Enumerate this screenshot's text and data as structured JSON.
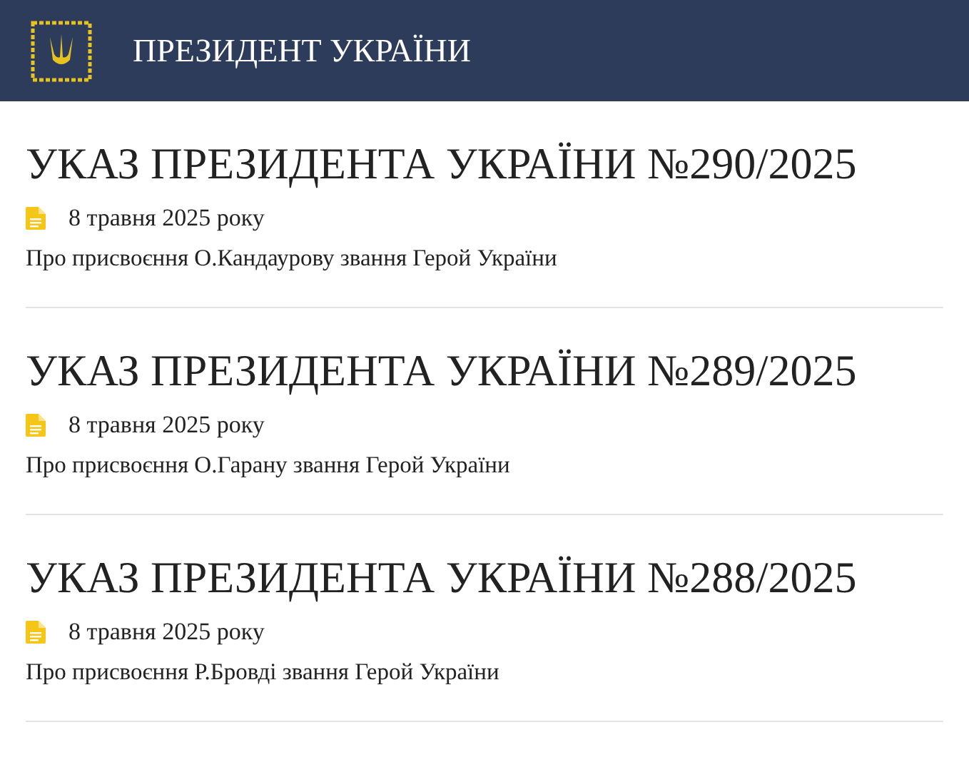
{
  "header": {
    "title": "ПРЕЗИДЕНТ УКРАЇНИ"
  },
  "decrees": [
    {
      "title": "УКАЗ ПРЕЗИДЕНТА УКРАЇНИ №290/2025",
      "date": "8 травня 2025 року",
      "summary": "Про присвоєння О.Кандаурову звання Герой України"
    },
    {
      "title": "УКАЗ ПРЕЗИДЕНТА УКРАЇНИ №289/2025",
      "date": "8 травня 2025 року",
      "summary": "Про присвоєння О.Гарану звання Герой України"
    },
    {
      "title": "УКАЗ ПРЕЗИДЕНТА УКРАЇНИ №288/2025",
      "date": "8 травня 2025 року",
      "summary": "Про присвоєння Р.Бровді звання Герой України"
    }
  ]
}
